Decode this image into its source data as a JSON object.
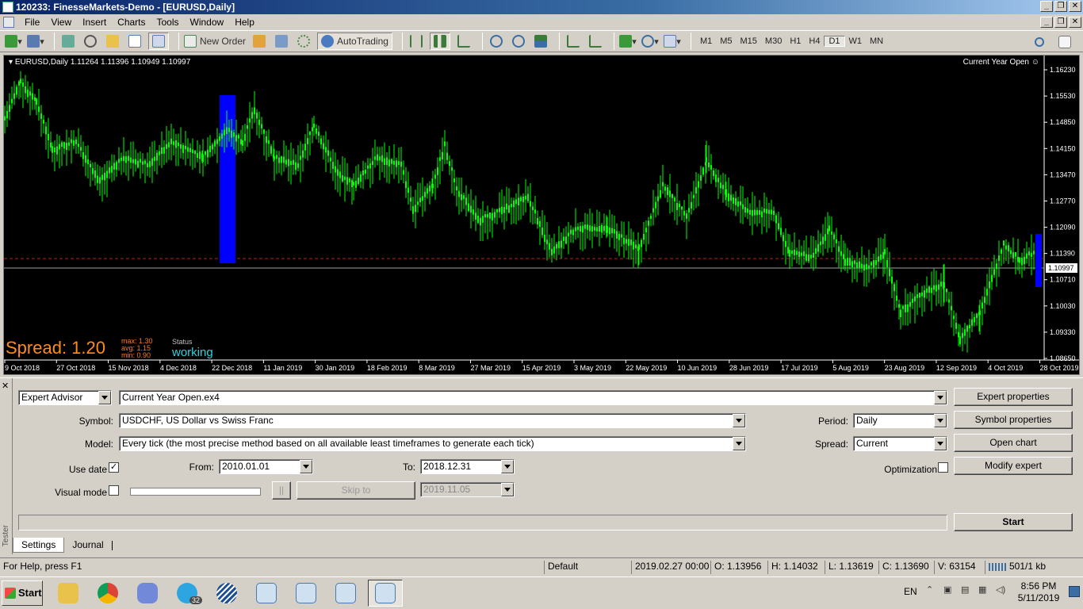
{
  "window": {
    "title": "120233: FinesseMarkets-Demo - [EURUSD,Daily]"
  },
  "menu": [
    "File",
    "View",
    "Insert",
    "Charts",
    "Tools",
    "Window",
    "Help"
  ],
  "toolbar": {
    "new_order": "New Order",
    "autotrading": "AutoTrading",
    "timeframes": [
      "M1",
      "M5",
      "M15",
      "M30",
      "H1",
      "H4",
      "D1",
      "W1",
      "MN"
    ],
    "active_timeframe": "D1"
  },
  "chart": {
    "header": "EURUSD,Daily  1.11264 1.11396 1.10949 1.10997",
    "ea_label": "Current Year Open",
    "price_labels": [
      "1.16230",
      "1.15530",
      "1.14850",
      "1.14150",
      "1.13470",
      "1.12770",
      "1.12090",
      "1.11390",
      "1.10997",
      "1.10710",
      "1.10030",
      "1.09330",
      "1.08650"
    ],
    "current_price": "1.10997",
    "date_labels": [
      "9 Oct 2018",
      "27 Oct 2018",
      "15 Nov 2018",
      "4 Dec 2018",
      "22 Dec 2018",
      "11 Jan 2019",
      "30 Jan 2019",
      "18 Feb 2019",
      "8 Mar 2019",
      "27 Mar 2019",
      "15 Apr 2019",
      "3 May 2019",
      "22 May 2019",
      "10 Jun 2019",
      "28 Jun 2019",
      "17 Jul 2019",
      "5 Aug 2019",
      "23 Aug 2019",
      "12 Sep 2019",
      "4 Oct 2019",
      "28 Oct 2019"
    ],
    "spread": "Spread: 1.20",
    "spread_max": "max: 1.30",
    "spread_avg": "avg: 1.15",
    "spread_min": "min: 0.90",
    "status_label": "Status",
    "status_value": "working",
    "colors": {
      "background": "#000000",
      "candles": "#00ff00",
      "highlight": "#0000ff",
      "spread": "#ff8c1a",
      "status": "#2ad4e0"
    }
  },
  "tester": {
    "side_label": "Tester",
    "type": "Expert Advisor",
    "expert": "Current Year Open.ex4",
    "symbol_label": "Symbol:",
    "symbol": "USDCHF, US Dollar vs Swiss Franc",
    "model_label": "Model:",
    "model": "Every tick (the most precise method based on all available least timeframes to generate each tick)",
    "use_date_label": "Use date",
    "from_label": "From:",
    "from": "2010.01.01",
    "to_label": "To:",
    "to": "2018.12.31",
    "visual_mode_label": "Visual mode",
    "pause_label": "||",
    "skip_to_label": "Skip to",
    "skip_to_date": "2019.11.05",
    "period_label": "Period:",
    "period": "Daily",
    "spread_label": "Spread:",
    "spread": "Current",
    "optimization_label": "Optimization",
    "buttons": {
      "expert_properties": "Expert properties",
      "symbol_properties": "Symbol properties",
      "open_chart": "Open chart",
      "modify_expert": "Modify expert",
      "start": "Start"
    },
    "tabs": [
      "Settings",
      "Journal"
    ]
  },
  "statusbar": {
    "help": "For Help, press F1",
    "profile": "Default",
    "datetime": "2019.02.27 00:00",
    "open": "O: 1.13956",
    "high": "H: 1.14032",
    "low": "L: 1.13619",
    "close": "C: 1.13690",
    "volume": "V: 63154",
    "traffic": "501/1 kb"
  },
  "taskbar": {
    "start": "Start",
    "telegram_badge": "32",
    "lang": "EN",
    "time": "8:56 PM",
    "date": "5/11/2019"
  }
}
